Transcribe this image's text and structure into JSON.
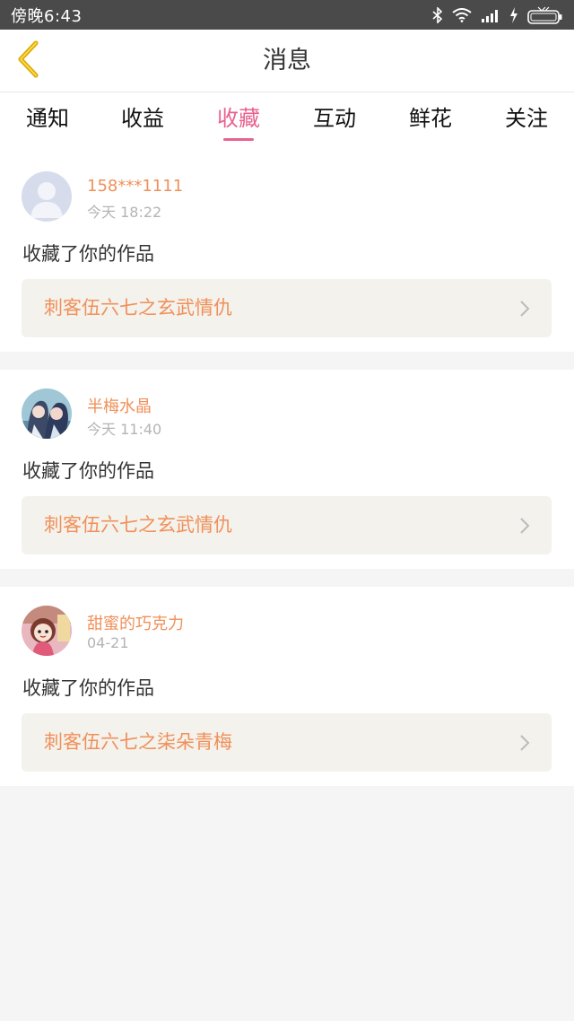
{
  "status_bar": {
    "time": "傍晚6:43",
    "icons": [
      "bluetooth-icon",
      "wifi-icon",
      "signal-icon",
      "charging-icon",
      "battery-icon"
    ]
  },
  "header": {
    "back_icon": "chevron-left-icon",
    "title": "消息"
  },
  "tabs": [
    {
      "label": "通知",
      "active": false
    },
    {
      "label": "收益",
      "active": false
    },
    {
      "label": "收藏",
      "active": true
    },
    {
      "label": "互动",
      "active": false
    },
    {
      "label": "鲜花",
      "active": false
    },
    {
      "label": "关注",
      "active": false
    }
  ],
  "messages": [
    {
      "username": "158***1111",
      "time": "今天 18:22",
      "action": "收藏了你的作品",
      "work_title": "刺客伍六七之玄武情仇",
      "avatar": "default-avatar"
    },
    {
      "username": "半梅水晶",
      "time": "今天 11:40",
      "action": "收藏了你的作品",
      "work_title": "刺客伍六七之玄武情仇",
      "avatar": "anime-girls-avatar"
    },
    {
      "username": "甜蜜的巧克力",
      "time": "04-21",
      "action": "收藏了你的作品",
      "work_title": "刺客伍六七之柒朵青梅",
      "avatar": "doll-avatar"
    }
  ],
  "colors": {
    "accent_pink": "#e8628f",
    "name_orange": "#f0905a",
    "back_icon_gold": "#d9a900",
    "status_bar": "#4a4a4a",
    "link_bg": "#f4f2ec"
  }
}
